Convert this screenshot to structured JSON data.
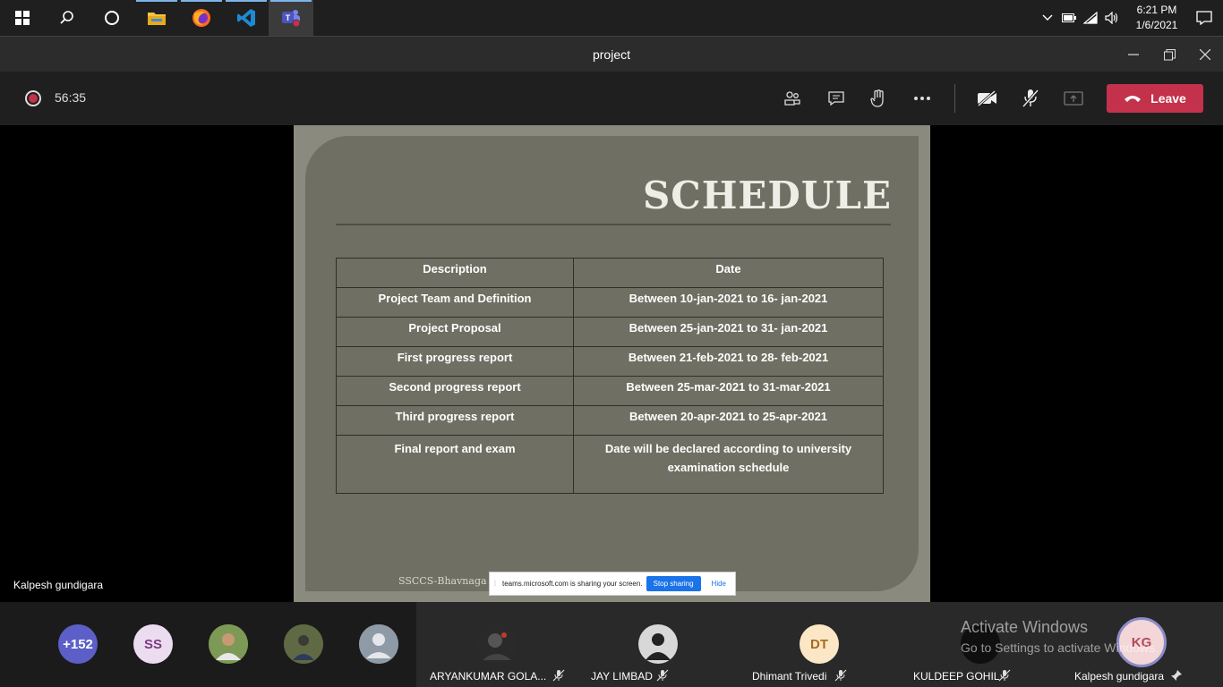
{
  "taskbar": {
    "apps": [
      "start-icon",
      "search-icon",
      "cortana-icon",
      "file-explorer-icon",
      "firefox-icon",
      "vscode-icon",
      "teams-icon"
    ],
    "clock_time": "6:21 PM",
    "clock_date": "1/6/2021"
  },
  "window": {
    "title": "project"
  },
  "call": {
    "timer": "56:35",
    "leave_label": "Leave",
    "leave_color": "#c4314b"
  },
  "slide": {
    "title": "SCHEDULE",
    "table": {
      "headers": [
        "Description",
        "Date"
      ],
      "rows": [
        [
          "Project Team and Definition",
          "Between 10-jan-2021 to 16- jan-2021"
        ],
        [
          "Project Proposal",
          "Between 25-jan-2021 to 31- jan-2021"
        ],
        [
          "First progress report",
          "Between 21-feb-2021  to 28- feb-2021"
        ],
        [
          "Second progress report",
          "Between 25-mar-2021 to 31-mar-2021"
        ],
        [
          "Third progress report",
          "Between 20-apr-2021 to 25-apr-2021"
        ],
        [
          "Final report and exam",
          "Date will be declared according to university examination schedule"
        ]
      ]
    },
    "footer": "SSCCS-Bhavnaga"
  },
  "presenter_label": "Kalpesh gundigara",
  "share_banner": {
    "message": "teams.microsoft.com is sharing your screen.",
    "stop_label": "Stop sharing",
    "hide_label": "Hide"
  },
  "participants": {
    "overflow": "+152",
    "ss_initials": "SS",
    "named": [
      {
        "name": "ARYANKUMAR GOLA...",
        "initials": ""
      },
      {
        "name": "JAY LIMBAD",
        "initials": ""
      },
      {
        "name": "Dhimant Trivedi",
        "initials": "DT"
      },
      {
        "name": "KULDEEP GOHIL",
        "initials": ""
      },
      {
        "name": "Kalpesh gundigara",
        "initials": "KG"
      }
    ]
  },
  "watermark": {
    "line1": "Activate Windows",
    "line2": "Go to Settings to activate Windows."
  }
}
